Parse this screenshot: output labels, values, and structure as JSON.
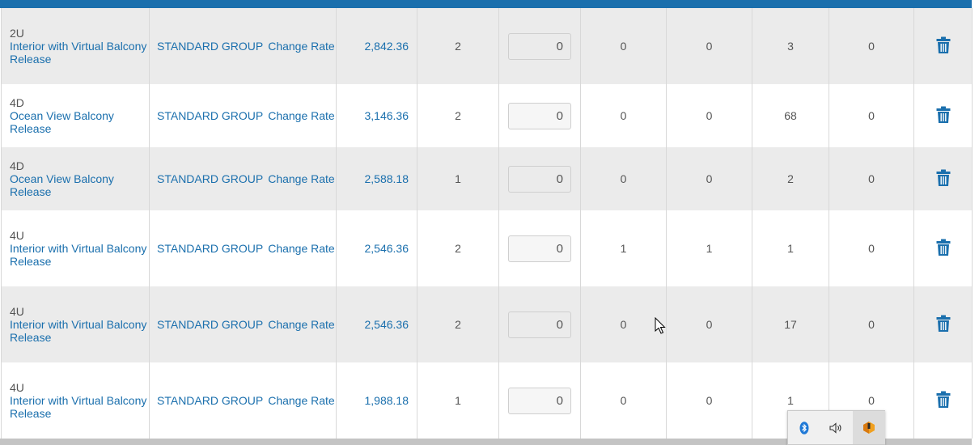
{
  "rows": [
    {
      "code": "2U",
      "name": "Interior with Virtual Balcony",
      "status": "Release",
      "group": "STANDARD GROUP",
      "change_rate": "Change Rate",
      "rate": "2,842.36",
      "c1": "2",
      "qty": "0",
      "c2": "0",
      "c3": "0",
      "c4": "3",
      "c5": "0"
    },
    {
      "code": "4D",
      "name": "Ocean View Balcony",
      "status": "Release",
      "group": "STANDARD GROUP",
      "change_rate": "Change Rate",
      "rate": "3,146.36",
      "c1": "2",
      "qty": "0",
      "c2": "0",
      "c3": "0",
      "c4": "68",
      "c5": "0"
    },
    {
      "code": "4D",
      "name": "Ocean View Balcony",
      "status": "Release",
      "group": "STANDARD GROUP",
      "change_rate": "Change Rate",
      "rate": "2,588.18",
      "c1": "1",
      "qty": "0",
      "c2": "0",
      "c3": "0",
      "c4": "2",
      "c5": "0"
    },
    {
      "code": "4U",
      "name": "Interior with Virtual Balcony",
      "status": "Release",
      "group": "STANDARD GROUP",
      "change_rate": "Change Rate",
      "rate": "2,546.36",
      "c1": "2",
      "qty": "0",
      "c2": "1",
      "c3": "1",
      "c4": "1",
      "c5": "0"
    },
    {
      "code": "4U",
      "name": "Interior with Virtual Balcony",
      "status": "Release",
      "group": "STANDARD GROUP",
      "change_rate": "Change Rate",
      "rate": "2,546.36",
      "c1": "2",
      "qty": "0",
      "c2": "0",
      "c3": "0",
      "c4": "17",
      "c5": "0"
    },
    {
      "code": "4U",
      "name": "Interior with Virtual Balcony",
      "status": "Release",
      "group": "STANDARD GROUP",
      "change_rate": "Change Rate",
      "rate": "1,988.18",
      "c1": "1",
      "qty": "0",
      "c2": "0",
      "c3": "0",
      "c4": "1",
      "c5": "0"
    }
  ],
  "icons": {
    "delete": "trash-icon",
    "tray": [
      "bluetooth-icon",
      "speaker-icon",
      "app-icon"
    ]
  },
  "colors": {
    "accent": "#1a6fad",
    "row_alt": "#ebebeb",
    "tray_orange": "#f0a020"
  }
}
